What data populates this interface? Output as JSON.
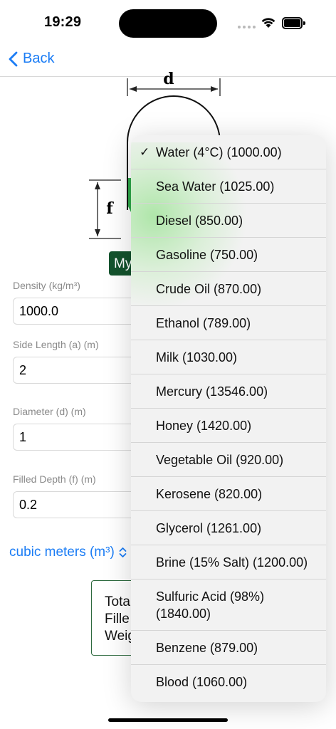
{
  "status_bar": {
    "time": "19:29"
  },
  "nav": {
    "back_label": "Back"
  },
  "diagram": {
    "label_d": "d",
    "label_f": "f"
  },
  "my_button": {
    "label": "My"
  },
  "form": {
    "density": {
      "label": "Density (kg/m³)",
      "value": "1000.0"
    },
    "side_length": {
      "label": "Side Length (a) (m)",
      "value": "2"
    },
    "diameter": {
      "label": "Diameter (d) (m)",
      "value": "1"
    },
    "filled_depth": {
      "label": "Filled Depth (f) (m)",
      "value": "0.2"
    }
  },
  "units": {
    "label": "cubic meters (m³)"
  },
  "result": {
    "line1": "Total",
    "line2": "Fille",
    "line3": "Weig"
  },
  "menu": {
    "selected_index": 0,
    "items": [
      {
        "label": "Water (4°C) (1000.00)",
        "selected": true
      },
      {
        "label": "Sea Water (1025.00)"
      },
      {
        "label": "Diesel (850.00)"
      },
      {
        "label": "Gasoline (750.00)"
      },
      {
        "label": "Crude Oil (870.00)"
      },
      {
        "label": "Ethanol (789.00)"
      },
      {
        "label": "Milk (1030.00)"
      },
      {
        "label": "Mercury (13546.00)"
      },
      {
        "label": "Honey (1420.00)"
      },
      {
        "label": "Vegetable Oil (920.00)"
      },
      {
        "label": "Kerosene (820.00)"
      },
      {
        "label": "Glycerol (1261.00)"
      },
      {
        "label": "Brine (15% Salt) (1200.00)"
      },
      {
        "label": "Sulfuric Acid (98%) (1840.00)"
      },
      {
        "label": "Benzene (879.00)"
      },
      {
        "label": "Blood (1060.00)"
      }
    ]
  },
  "colors": {
    "accent": "#1a7cf5",
    "button_green": "#14532d",
    "menu_bg": "#f2f2f2"
  }
}
